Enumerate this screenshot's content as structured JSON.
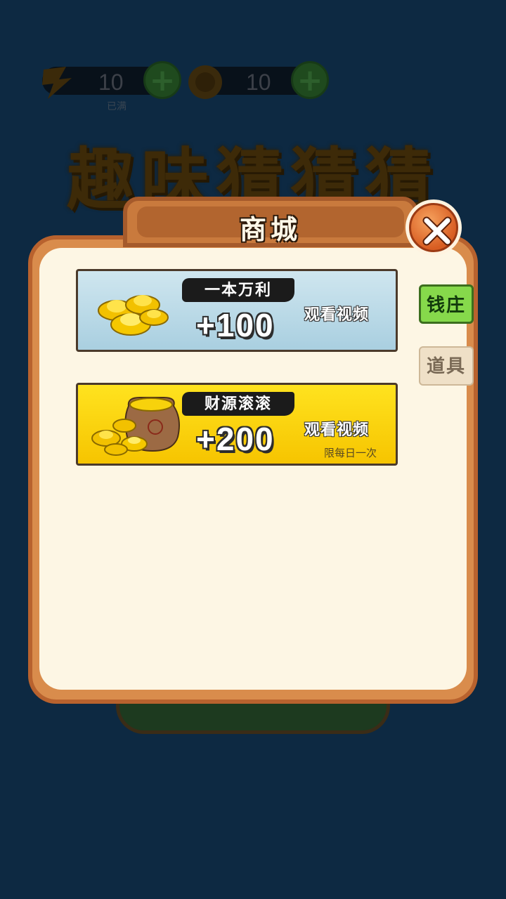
{
  "background": {
    "energy": {
      "value": "10",
      "sub_label": "已满",
      "icon": "lightning-icon"
    },
    "coins": {
      "value": "10",
      "icon": "coin-icon"
    },
    "game_title": "趣味猜猜猜"
  },
  "shop": {
    "title": "商城",
    "close_icon": "close-icon",
    "tabs": [
      {
        "label": "钱庄",
        "active": true
      },
      {
        "label": "道具",
        "active": false
      }
    ],
    "offers": [
      {
        "name": "一本万利",
        "amount": "+100",
        "action": "观看视频",
        "limit": "",
        "art": "gold-ingots-icon"
      },
      {
        "name": "财源滚滚",
        "amount": "+200",
        "action": "观看视频",
        "limit": "限每日一次",
        "art": "gold-sack-icon"
      }
    ]
  },
  "colors": {
    "modal_frame": "#d98c4c",
    "modal_inner": "#fdf6e4",
    "offer_blue": "#bfdbe8",
    "offer_gold": "#f8cf0a",
    "tab_active": "#86d94b"
  }
}
